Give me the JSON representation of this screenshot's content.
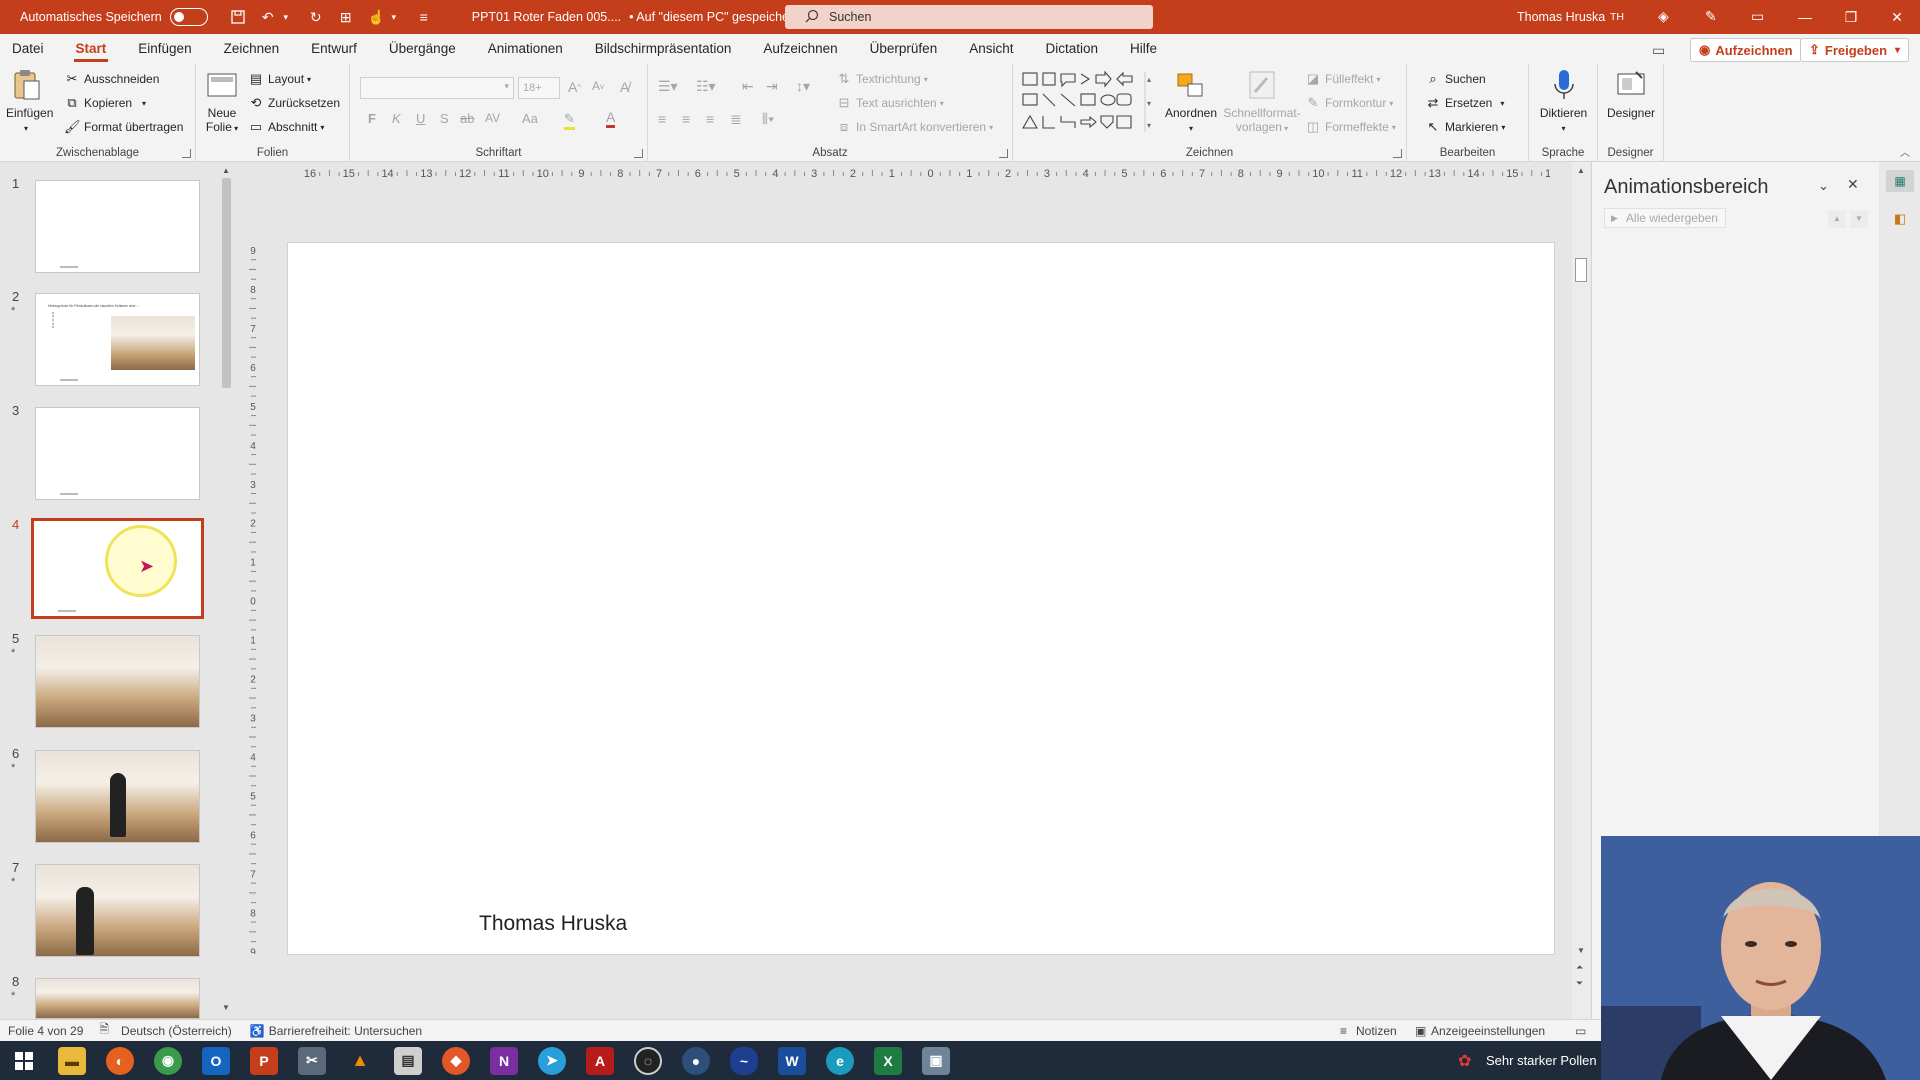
{
  "titlebar": {
    "autosave_label": "Automatisches Speichern",
    "doc_title": "PPT01 Roter Faden 005....",
    "save_state": "• Auf \"diesem PC\" gespeichert",
    "search_placeholder": "Suchen",
    "user_name": "Thomas Hruska",
    "user_initials": "TH"
  },
  "menu": {
    "tabs": [
      "Datei",
      "Start",
      "Einfügen",
      "Zeichnen",
      "Entwurf",
      "Übergänge",
      "Animationen",
      "Bildschirmpräsentation",
      "Aufzeichnen",
      "Überprüfen",
      "Ansicht",
      "Dictation",
      "Hilfe"
    ],
    "active": "Start",
    "record_label": "Aufzeichnen",
    "share_label": "Freigeben"
  },
  "ribbon": {
    "clipboard": {
      "label": "Zwischenablage",
      "paste": "Einfügen",
      "cut": "Ausschneiden",
      "copy": "Kopieren",
      "format_painter": "Format übertragen"
    },
    "slides": {
      "label": "Folien",
      "new_slide_1": "Neue",
      "new_slide_2": "Folie",
      "layout": "Layout",
      "reset": "Zurücksetzen",
      "section": "Abschnitt"
    },
    "font": {
      "label": "Schriftart",
      "size": "18+",
      "bold": "F",
      "italic": "K",
      "underline": "U",
      "strike": "S",
      "abc": "ab",
      "spacing": "AV",
      "case": "Aa"
    },
    "paragraph": {
      "label": "Absatz",
      "text_direction": "Textrichtung",
      "align_text": "Text ausrichten",
      "smartart": "In SmartArt konvertieren"
    },
    "drawing": {
      "label": "Zeichnen",
      "arrange": "Anordnen",
      "quick_styles_1": "Schnellformat-",
      "quick_styles_2": "vorlagen",
      "fill": "Fülleffekt",
      "outline": "Formkontur",
      "effects": "Formeffekte"
    },
    "editing": {
      "label": "Bearbeiten",
      "find": "Suchen",
      "replace": "Ersetzen",
      "select": "Markieren"
    },
    "voice": {
      "label": "Sprache",
      "dictate": "Diktieren"
    },
    "designer": {
      "label": "Designer",
      "button": "Designer"
    }
  },
  "thumbnails": {
    "items": [
      {
        "num": "1",
        "star": ""
      },
      {
        "num": "2",
        "star": "*",
        "title": "Hintergründe für Filmkulissen die visuellen Kulissen sind ..."
      },
      {
        "num": "3",
        "star": ""
      },
      {
        "num": "4",
        "star": ""
      },
      {
        "num": "5",
        "star": "*"
      },
      {
        "num": "6",
        "star": "*"
      },
      {
        "num": "7",
        "star": "*"
      },
      {
        "num": "8",
        "star": "*"
      }
    ]
  },
  "ruler": {
    "h_ticks": [
      "16",
      "15",
      "14",
      "13",
      "12",
      "11",
      "10",
      "9",
      "8",
      "7",
      "6",
      "5",
      "4",
      "3",
      "2",
      "1",
      "0",
      "1",
      "2",
      "3",
      "4",
      "5",
      "6",
      "7",
      "8",
      "9",
      "10",
      "11",
      "12",
      "13",
      "14",
      "15",
      "16"
    ],
    "v_ticks": [
      "9",
      "8",
      "7",
      "6",
      "5",
      "4",
      "3",
      "2",
      "1",
      "0",
      "1",
      "2",
      "3",
      "4",
      "5",
      "6",
      "7",
      "8",
      "9"
    ]
  },
  "slide": {
    "footer_text": "Thomas Hruska"
  },
  "animpane": {
    "title": "Animationsbereich",
    "play_all": "Alle wiedergeben"
  },
  "status": {
    "slide_pos": "Folie 4 von 29",
    "language": "Deutsch (Österreich)",
    "accessibility": "Barrierefreiheit: Untersuchen",
    "notes": "Notizen",
    "display_settings": "Anzeigeeinstellungen"
  },
  "taskbar": {
    "weather": "Sehr starker Pollen",
    "colors": {
      "accent": "#c43e1c",
      "taskbar": "#1f2a3a"
    }
  }
}
